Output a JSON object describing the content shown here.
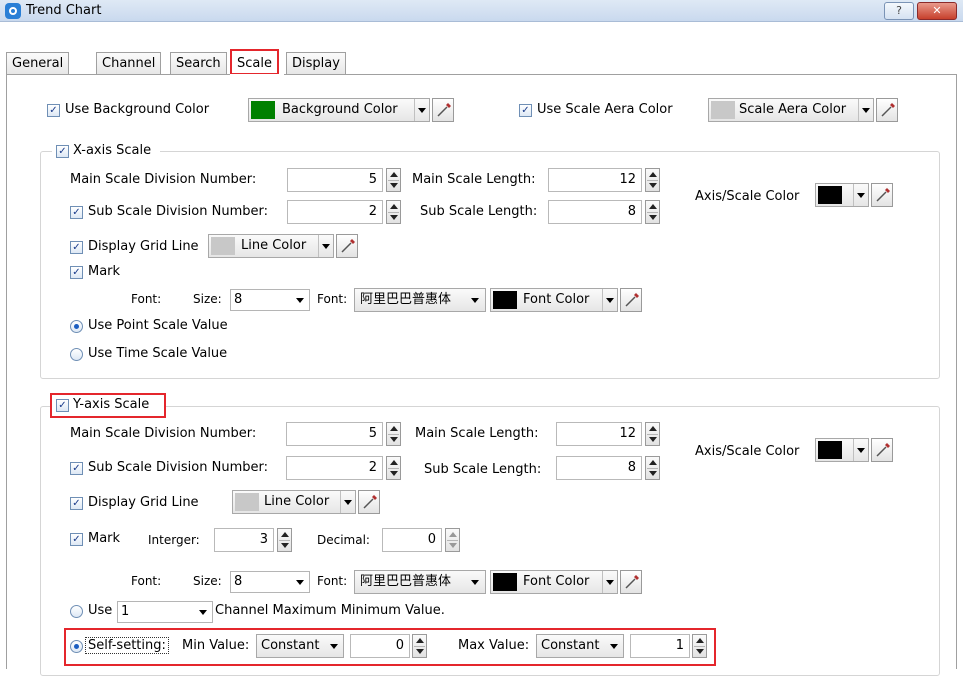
{
  "window": {
    "title": "Trend Chart",
    "help_label": "?",
    "close_label": "✕"
  },
  "tabs": [
    "General",
    "Channel",
    "Search",
    "Scale",
    "Display"
  ],
  "colors": {
    "background_swatch": "#008000",
    "scale_area_swatch": "#c8c8c8",
    "line_swatch": "#c8c8c8",
    "axis_swatch": "#000000",
    "font_swatch": "#000000",
    "highlight": "#e4262c"
  },
  "top": {
    "use_bg_color": "Use Background Color",
    "bg_color_label": "Background Color",
    "use_scale_area_color": "Use Scale Aera Color",
    "scale_area_color_label": "Scale Aera Color"
  },
  "x_axis": {
    "title": "X-axis Scale",
    "main_div_label": "Main Scale Division Number:",
    "main_div_value": "5",
    "main_len_label": "Main Scale Length:",
    "main_len_value": "12",
    "sub_div_label": "Sub Scale Division Number:",
    "sub_div_value": "2",
    "sub_len_label": "Sub Scale Length:",
    "sub_len_value": "8",
    "axis_color_label": "Axis/Scale Color",
    "grid_label": "Display Grid Line",
    "line_color_label": "Line Color",
    "mark_label": "Mark",
    "font_label": "Font:",
    "size_label": "Size:",
    "size_value": "8",
    "font_name_label": "Font:",
    "font_name_value": "阿里巴巴普惠体",
    "font_color_label": "Font Color",
    "point_scale_label": "Use Point Scale Value",
    "time_scale_label": "Use Time Scale Value"
  },
  "y_axis": {
    "title": "Y-axis Scale",
    "main_div_label": "Main Scale Division Number:",
    "main_div_value": "5",
    "main_len_label": "Main Scale Length:",
    "main_len_value": "12",
    "sub_div_label": "Sub Scale Division Number:",
    "sub_div_value": "2",
    "sub_len_label": "Sub Scale Length:",
    "sub_len_value": "8",
    "axis_color_label": "Axis/Scale Color",
    "grid_label": "Display Grid Line",
    "line_color_label": "Line Color",
    "mark_label": "Mark",
    "integer_label": "Interger:",
    "integer_value": "3",
    "decimal_label": "Decimal:",
    "decimal_value": "0",
    "font_label": "Font:",
    "size_label": "Size:",
    "size_value": "8",
    "font_name_label": "Font:",
    "font_name_value": "阿里巴巴普惠体",
    "font_color_label": "Font Color",
    "use_label": "Use",
    "channel_value": "1",
    "channel_suffix": "Channel Maximum Minimum Value.",
    "self_setting_label": "Self-setting:",
    "min_label": "Min Value:",
    "min_mode": "Constant",
    "min_value": "0",
    "max_label": "Max Value:",
    "max_mode": "Constant",
    "max_value": "1"
  }
}
